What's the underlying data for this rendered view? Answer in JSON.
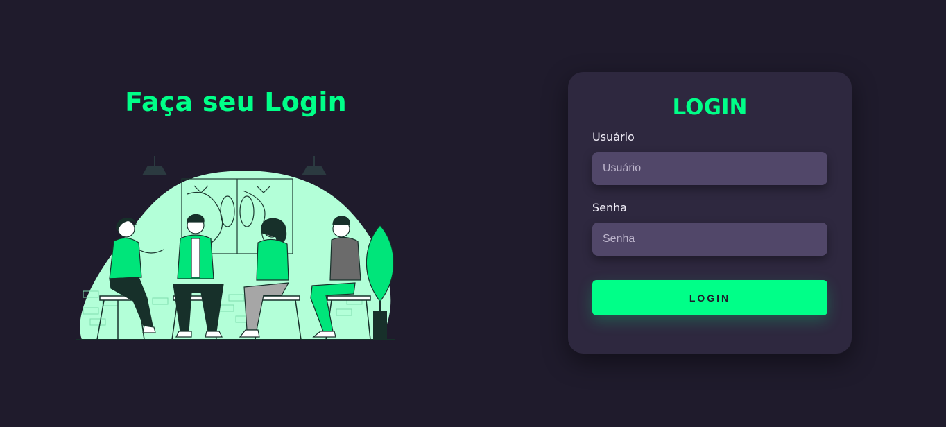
{
  "hero": {
    "title": "Faça seu Login"
  },
  "login_card": {
    "title": "LOGIN",
    "username": {
      "label": "Usuário",
      "placeholder": "Usuário",
      "value": ""
    },
    "password": {
      "label": "Senha",
      "placeholder": "Senha",
      "value": ""
    },
    "submit_label": "LOGIN"
  },
  "colors": {
    "background": "#1f1b2c",
    "card": "#2e283f",
    "input": "#514769",
    "accent": "#00ff88",
    "illustration_bg": "#b3ffd8"
  }
}
